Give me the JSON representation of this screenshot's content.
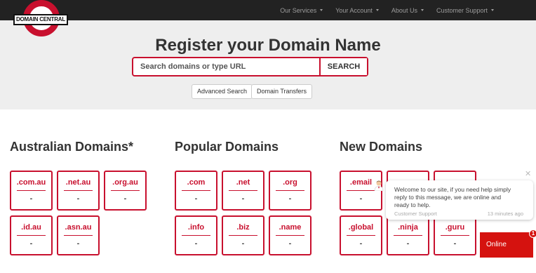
{
  "brand": {
    "logo_text": "DOMAIN CENTRAL",
    "accent": "#c8102e",
    "nav_bg": "#222222",
    "hero_bg": "#eeeeee"
  },
  "nav": [
    {
      "label": "Our Services"
    },
    {
      "label": "Your Account"
    },
    {
      "label": "About Us"
    },
    {
      "label": "Customer Support"
    }
  ],
  "hero": {
    "title": "Register your Domain Name",
    "search_placeholder": "Search domains or type URL",
    "search_button": "SEARCH",
    "advanced_search": "Advanced Search",
    "domain_transfers": "Domain Transfers"
  },
  "columns": [
    {
      "title": "Australian Domains*",
      "tiles": [
        {
          "name": ".com.au",
          "price": "-"
        },
        {
          "name": ".net.au",
          "price": "-"
        },
        {
          "name": ".org.au",
          "price": "-"
        },
        {
          "name": ".id.au",
          "price": "-"
        },
        {
          "name": ".asn.au",
          "price": "-"
        }
      ]
    },
    {
      "title": "Popular Domains",
      "tiles": [
        {
          "name": ".com",
          "price": "-"
        },
        {
          "name": ".net",
          "price": "-"
        },
        {
          "name": ".org",
          "price": "-"
        },
        {
          "name": ".info",
          "price": "-"
        },
        {
          "name": ".biz",
          "price": "-"
        },
        {
          "name": ".name",
          "price": "-"
        }
      ]
    },
    {
      "title": "New Domains",
      "tiles": [
        {
          "name": ".email",
          "price": "-"
        },
        {
          "name": "",
          "price": ""
        },
        {
          "name": "",
          "price": ""
        },
        {
          "name": ".global",
          "price": "-"
        },
        {
          "name": ".ninja",
          "price": "-"
        },
        {
          "name": ".guru",
          "price": "-"
        }
      ]
    }
  ],
  "chat": {
    "message": "Welcome to our site, if you need help simply reply to this message, we are online and ready to help.",
    "agent": "Customer Support",
    "time": "13 minutes ago",
    "status_label": "Online",
    "badge_count": "1",
    "close_icon": "close-icon",
    "avatar_icon": "agent-avatar-icon"
  }
}
